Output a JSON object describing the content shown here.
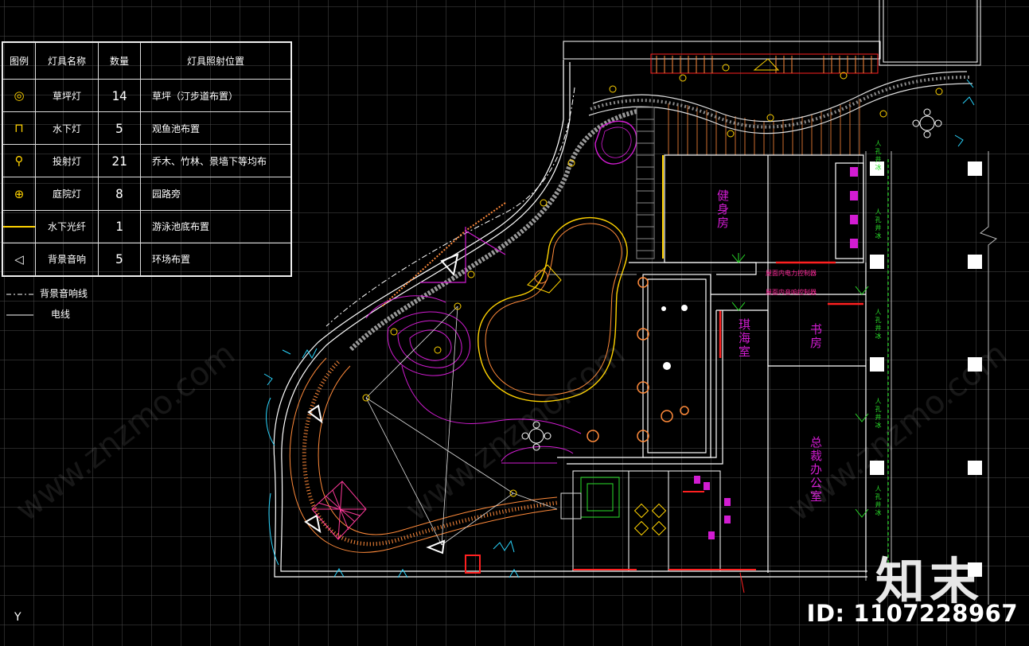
{
  "title_fragment": "",
  "legend": {
    "headers": [
      "图例",
      "灯具名称",
      "数量",
      "灯具照射位置"
    ],
    "rows": [
      {
        "icon": "lawn-light-icon",
        "glyph": "◎",
        "name": "草坪灯",
        "qty": "14",
        "position": "草坪（汀步道布置）"
      },
      {
        "icon": "underwater-light-icon",
        "glyph": "⊓",
        "name": "水下灯",
        "qty": "5",
        "position": "观鱼池布置"
      },
      {
        "icon": "spotlight-icon",
        "glyph": "⚲",
        "name": "投射灯",
        "qty": "21",
        "position": "乔木、竹林、景墙下等均布"
      },
      {
        "icon": "courtyard-light-icon",
        "glyph": "⊕",
        "name": "庭院灯",
        "qty": "8",
        "position": "园路旁"
      },
      {
        "icon": "fiber-optic-line-icon",
        "glyph": "",
        "name": "水下光纤",
        "qty": "1",
        "position": "游泳池底布置"
      },
      {
        "icon": "speaker-icon",
        "glyph": "◁",
        "name": "背景音响",
        "qty": "5",
        "position": "环场布置"
      }
    ]
  },
  "line_legend": [
    {
      "style": "dash-dot",
      "label": "背景音响线"
    },
    {
      "style": "solid",
      "label": "电线"
    }
  ],
  "rooms": {
    "gym": "健身房",
    "tea_room": "琪海室",
    "study": "书房",
    "ceo_office": "总裁办公室",
    "power_panel": "屋面内电力控制器",
    "audio_panel": "屋面内音响控制器"
  },
  "side_labels": [
    "人孔井冰",
    "人孔井冰",
    "人孔井冰",
    "人孔井冰",
    "人孔井冰"
  ],
  "axis_label": "Y",
  "watermark": {
    "logo": "知末",
    "id": "ID: 1107228967",
    "site": "www.znzmo.com"
  },
  "colors": {
    "background": "#000000",
    "grid": "#464646",
    "magenta": "#d21cd2",
    "yellow": "#ffd200",
    "orange": "#ff8a3a",
    "cyan": "#2ad6ff",
    "green": "#2ae02a",
    "red": "#ff2020",
    "white": "#ffffff"
  }
}
